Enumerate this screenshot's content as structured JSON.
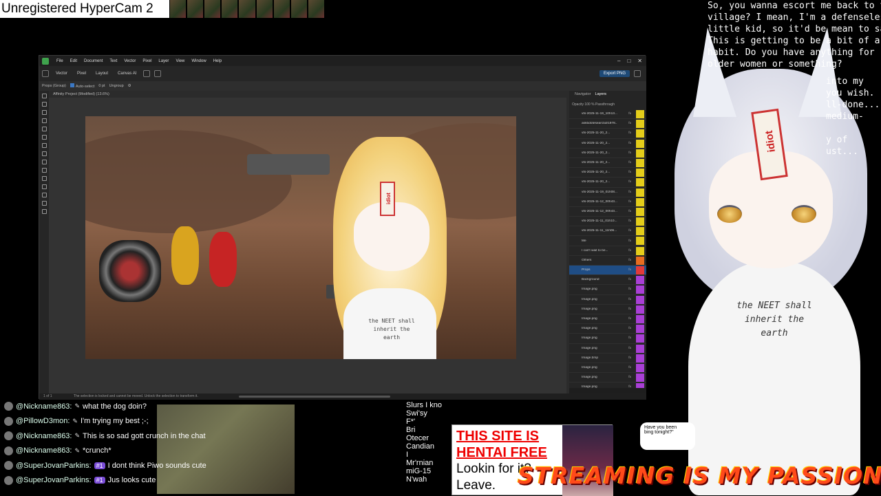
{
  "recorder": {
    "watermark": "Unregistered HyperCam 2"
  },
  "dialogue": {
    "left_lines": "So, you wanna escort me back to the\nvillage? I mean, I'm a defenseless\nlittle kid, so it'd be mean to say no!\nThis is getting to be a bit of a\nhabit. Do you have anything for\nolder women or something?",
    "right_lines": "into my\nyou wish.\nll-done...\nmedium-\n\ny of\nust..."
  },
  "app": {
    "menu": [
      "File",
      "Edit",
      "Document",
      "Vector",
      "Pixel",
      "Layer",
      "View",
      "Window",
      "Help"
    ],
    "personas": [
      "Vector",
      "Pixel",
      "Layout",
      "Canvas AI"
    ],
    "export_label": "Export PNG",
    "context": {
      "selection": "Props (Group)",
      "auto_select": "Auto-select",
      "stroke": "0 pt",
      "ungroup": "Ungroup"
    },
    "doc_title": "Affinity Project (Modified) (13.6%)",
    "status": "The selection is locked and cannot be moved. Unlock the selection to transform it.",
    "page_indicator": "1 of 1",
    "panel": {
      "tabs": [
        "Navigator",
        "Layers"
      ],
      "active_tab": "Layers",
      "opacity_label": "Opacity",
      "opacity_value": "100 %",
      "blend_mode": "Passthrough",
      "layers": [
        {
          "name": "vts-2025-11-19_10h13...",
          "vis": "vy"
        },
        {
          "name": "askbdotesearcbdr1978...",
          "vis": "vy"
        },
        {
          "name": "vts-2025-11-20_2...",
          "vis": "vy"
        },
        {
          "name": "vts-2025-11-20_2...",
          "vis": "vy"
        },
        {
          "name": "vts-2025-11-20_2...",
          "vis": "vy"
        },
        {
          "name": "vts-2025-11-20_2...",
          "vis": "vy"
        },
        {
          "name": "vts-2025-11-20_2...",
          "vis": "vy"
        },
        {
          "name": "vts-2025-11-20_2...",
          "vis": "vy"
        },
        {
          "name": "vts-2025-11-19_01h08...",
          "vis": "vy"
        },
        {
          "name": "vts-2025-11-12_00h43...",
          "vis": "vy"
        },
        {
          "name": "vts-2025-11-12_00h43...",
          "vis": "vy"
        },
        {
          "name": "vts-2025-11-11_01h10...",
          "vis": "vy"
        },
        {
          "name": "vts-2025-11-11_11h06...",
          "vis": "vy"
        },
        {
          "name": "Me",
          "vis": "vy"
        },
        {
          "name": "I can't wait to be...",
          "vis": "vy"
        },
        {
          "name": "Others",
          "vis": "vo"
        },
        {
          "name": "Props",
          "vis": "vr",
          "selected": true
        },
        {
          "name": "Background",
          "vis": "vp"
        },
        {
          "name": "Image.png",
          "vis": "vp"
        },
        {
          "name": "Image.png",
          "vis": "vp"
        },
        {
          "name": "Image.png",
          "vis": "vp"
        },
        {
          "name": "Image.png",
          "vis": "vp"
        },
        {
          "name": "Image.png",
          "vis": "vp"
        },
        {
          "name": "Image.png",
          "vis": "vp"
        },
        {
          "name": "Image.png",
          "vis": "vp"
        },
        {
          "name": "Image.bmp",
          "vis": "vp"
        },
        {
          "name": "Image.png",
          "vis": "vp"
        },
        {
          "name": "Image.png",
          "vis": "vp"
        },
        {
          "name": "Image.png",
          "vis": "vp"
        }
      ]
    },
    "artboard_shirt": "the NEET shall\ninherit the\nearth",
    "talisman": "idiot"
  },
  "chat": [
    {
      "user": "@Nickname863:",
      "msg": "what the dog doin?",
      "badge": ""
    },
    {
      "user": "@PillowD3mon:",
      "msg": "I'm trying my best ;-;",
      "badge": ""
    },
    {
      "user": "@Nickname863:",
      "msg": "This is so sad gott crunch in the chat",
      "badge": ""
    },
    {
      "user": "@Nickname863:",
      "msg": "*crunch*",
      "badge": ""
    },
    {
      "user": "@SuperJovanParkins:",
      "msg": "I dont think Piwo sounds cute",
      "badge": "#1"
    },
    {
      "user": "@SuperJovanParkins:",
      "msg": "Jus looks cute",
      "badge": "#1"
    }
  ],
  "right_list": "Slurs I kno\nSwi'sy\nF*'\nBri\nOtecer\nCandian\nI\nMr'rnian\nmiG-15\nN'wah",
  "ad": {
    "headline": "THIS SITE IS\nHENTAI FREE",
    "sub": "Lookin for it?\nLeave.",
    "tonight": "Have you been\nbing tonight?\""
  },
  "banner": "STREAMING IS MY PASSION",
  "mascot": {
    "shirt": "the NEET shall\ninherit the\nearth",
    "talisman": "idiot"
  },
  "colors": {
    "accent": "#1e4a77",
    "layer_yellow": "#e4cd1a",
    "layer_orange": "#e86c20",
    "layer_red": "#e23a3a",
    "layer_purple": "#a93fd6",
    "banner": "#ff4a1a"
  }
}
